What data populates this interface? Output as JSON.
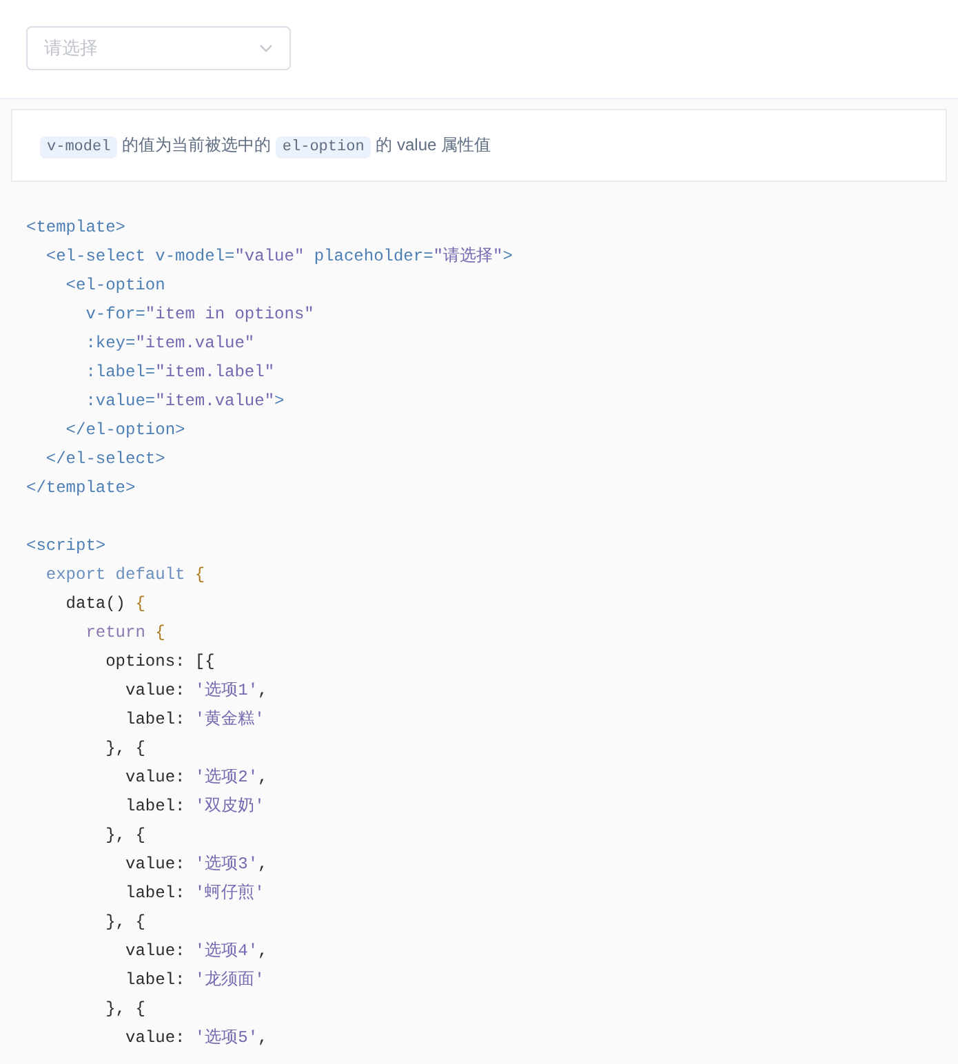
{
  "select": {
    "placeholder": "请选择"
  },
  "description": [
    {
      "kind": "code",
      "text": "v-model"
    },
    {
      "kind": "text",
      "text": " 的值为当前被选中的 "
    },
    {
      "kind": "code",
      "text": "el-option"
    },
    {
      "kind": "text",
      "text": " 的 value 属性值"
    }
  ],
  "template_code": [
    [
      {
        "kind": "tag",
        "text": "<template>"
      }
    ],
    [
      {
        "kind": "tag",
        "text": "  <el-select "
      },
      {
        "kind": "attr",
        "text": "v-model="
      },
      {
        "kind": "string",
        "text": "\"value\""
      },
      {
        "kind": "attr",
        "text": " placeholder="
      },
      {
        "kind": "string",
        "text": "\"请选择\""
      },
      {
        "kind": "tag",
        "text": ">"
      }
    ],
    [
      {
        "kind": "tag",
        "text": "    <el-option"
      }
    ],
    [
      {
        "kind": "attr",
        "text": "      v-for="
      },
      {
        "kind": "string",
        "text": "\"item in options\""
      }
    ],
    [
      {
        "kind": "attr",
        "text": "      :key="
      },
      {
        "kind": "string",
        "text": "\"item.value\""
      }
    ],
    [
      {
        "kind": "attr",
        "text": "      :label="
      },
      {
        "kind": "string",
        "text": "\"item.label\""
      }
    ],
    [
      {
        "kind": "attr",
        "text": "      :value="
      },
      {
        "kind": "string",
        "text": "\"item.value\""
      },
      {
        "kind": "tag",
        "text": ">"
      }
    ],
    [
      {
        "kind": "tag",
        "text": "    </el-option>"
      }
    ],
    [
      {
        "kind": "tag",
        "text": "  </el-select>"
      }
    ],
    [
      {
        "kind": "tag",
        "text": "</template>"
      }
    ]
  ],
  "script_code": [
    [
      {
        "kind": "tag",
        "text": "<script>"
      }
    ],
    [
      {
        "kind": "keyword",
        "text": "  export default "
      },
      {
        "kind": "brace",
        "text": "{"
      }
    ],
    [
      {
        "kind": "plain",
        "text": "    data() "
      },
      {
        "kind": "brace",
        "text": "{"
      }
    ],
    [
      {
        "kind": "return",
        "text": "      return "
      },
      {
        "kind": "brace",
        "text": "{"
      }
    ],
    [
      {
        "kind": "plain",
        "text": "        options: [{"
      }
    ],
    [
      {
        "kind": "plain",
        "text": "          value: "
      },
      {
        "kind": "string",
        "text": "'选项1'"
      },
      {
        "kind": "plain",
        "text": ","
      }
    ],
    [
      {
        "kind": "plain",
        "text": "          label: "
      },
      {
        "kind": "string",
        "text": "'黄金糕'"
      }
    ],
    [
      {
        "kind": "plain",
        "text": "        }, {"
      }
    ],
    [
      {
        "kind": "plain",
        "text": "          value: "
      },
      {
        "kind": "string",
        "text": "'选项2'"
      },
      {
        "kind": "plain",
        "text": ","
      }
    ],
    [
      {
        "kind": "plain",
        "text": "          label: "
      },
      {
        "kind": "string",
        "text": "'双皮奶'"
      }
    ],
    [
      {
        "kind": "plain",
        "text": "        }, {"
      }
    ],
    [
      {
        "kind": "plain",
        "text": "          value: "
      },
      {
        "kind": "string",
        "text": "'选项3'"
      },
      {
        "kind": "plain",
        "text": ","
      }
    ],
    [
      {
        "kind": "plain",
        "text": "          label: "
      },
      {
        "kind": "string",
        "text": "'蚵仔煎'"
      }
    ],
    [
      {
        "kind": "plain",
        "text": "        }, {"
      }
    ],
    [
      {
        "kind": "plain",
        "text": "          value: "
      },
      {
        "kind": "string",
        "text": "'选项4'"
      },
      {
        "kind": "plain",
        "text": ","
      }
    ],
    [
      {
        "kind": "plain",
        "text": "          label: "
      },
      {
        "kind": "string",
        "text": "'龙须面'"
      }
    ],
    [
      {
        "kind": "plain",
        "text": "        }, {"
      }
    ],
    [
      {
        "kind": "plain",
        "text": "          value: "
      },
      {
        "kind": "string",
        "text": "'选项5'"
      },
      {
        "kind": "plain",
        "text": ","
      }
    ]
  ]
}
